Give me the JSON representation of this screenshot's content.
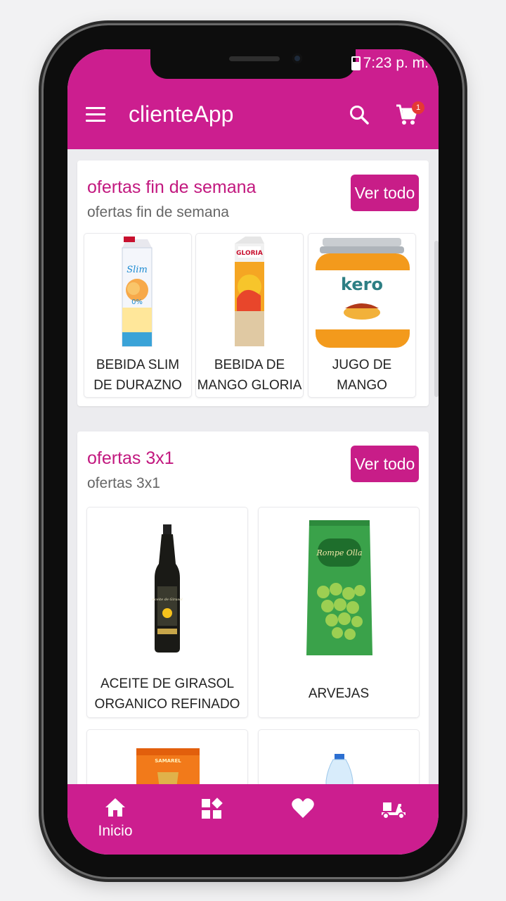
{
  "status": {
    "time": "7:23 p. m."
  },
  "appbar": {
    "title": "clienteApp",
    "cart_count": "1"
  },
  "sections": [
    {
      "title": "ofertas fin de semana",
      "subtitle": "ofertas fin de semana",
      "button": "Ver todo",
      "products": [
        {
          "line1": "BEBIDA SLIM",
          "line2": "DE DURAZNO"
        },
        {
          "line1": "BEBIDA DE",
          "line2": "MANGO GLORIA"
        },
        {
          "line1": "JUGO DE",
          "line2": "MANGO"
        }
      ]
    },
    {
      "title": "ofertas 3x1",
      "subtitle": "ofertas 3x1",
      "button": "Ver todo",
      "products": [
        {
          "line1": "ACEITE DE GIRASOL",
          "line2": "ORGANICO REFINADO"
        },
        {
          "line1": "ARVEJAS",
          "line2": ""
        }
      ]
    }
  ],
  "product_images": {
    "slim": {
      "brand": "Slim",
      "label": "0%"
    },
    "gloria": {
      "brand": "GLORIA"
    },
    "kero": {
      "brand": "kero"
    },
    "aceite": {
      "brand": "Aceite de Girasol"
    },
    "arvejas": {
      "brand": "Rompe Olla"
    },
    "bag": {
      "brand": "SAMAREL"
    }
  },
  "bottom_nav": {
    "home_label": "Inicio"
  },
  "colors": {
    "primary": "#cc1e8f",
    "title_text": "#c2187f"
  }
}
